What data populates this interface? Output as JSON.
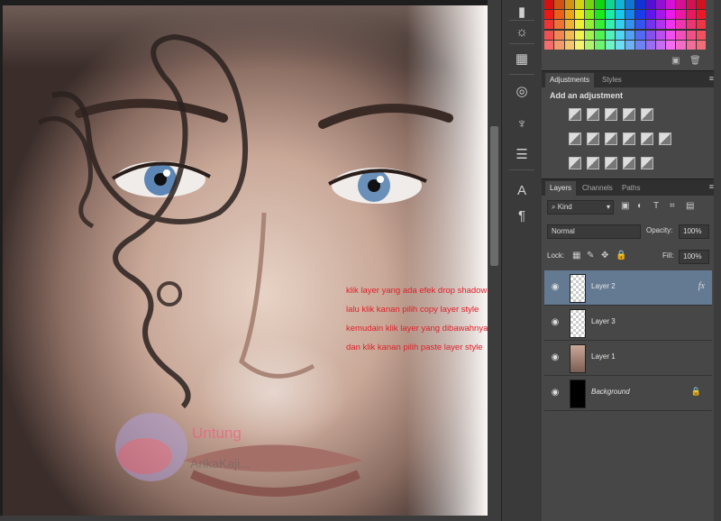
{
  "annotation": {
    "lines": [
      "klik layer yang ada efek drop shadownya",
      "lalu klik kanan pilih copy layer style",
      "kemudain klik layer yang dibawahnya",
      "dan klik kanan pilih paste layer style"
    ]
  },
  "watermark": {
    "line1": "Untung",
    "line2": "ArikaKaji..."
  },
  "panels": {
    "adjustments_tabs": [
      "Adjustments",
      "Styles"
    ],
    "adjustments_title": "Add an adjustment",
    "layers_tabs": [
      "Layers",
      "Channels",
      "Paths"
    ],
    "kind_filter": "Kind",
    "blend_mode": "Normal",
    "opacity_label": "Opacity:",
    "opacity_value": "100%",
    "lock_label": "Lock:",
    "fill_label": "Fill:",
    "fill_value": "100%"
  },
  "layers": [
    {
      "name": "Layer 2",
      "selected": true,
      "fx": "fx"
    },
    {
      "name": "Layer 3",
      "selected": false
    },
    {
      "name": "Layer 1",
      "selected": false
    },
    {
      "name": "Background",
      "selected": false,
      "locked": true
    }
  ],
  "icons": {
    "tools": [
      "histogram-icon",
      "info-icon",
      "brush-preset-icon",
      "adjust-icon",
      "properties-icon",
      "character-icon",
      "paragraph-icon"
    ],
    "eye": "eye-icon",
    "lock": "lock-icon"
  },
  "colors": {
    "accent_selected": "#647a93",
    "annotation_text": "#e0202a",
    "panel_bg": "#474747"
  }
}
